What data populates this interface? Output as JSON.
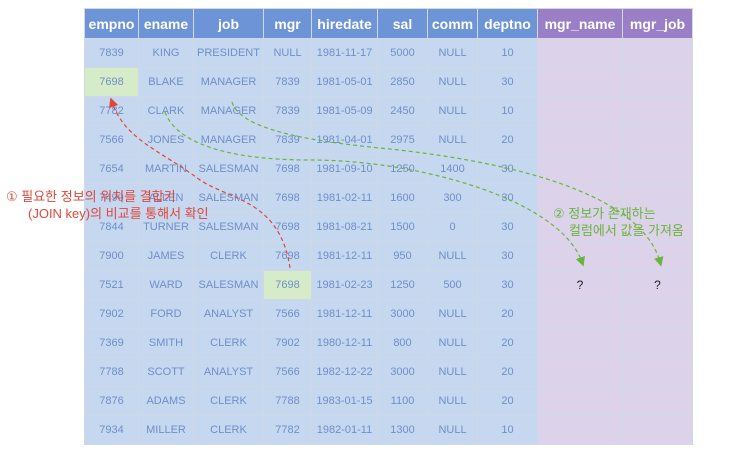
{
  "columns": [
    "empno",
    "ename",
    "job",
    "mgr",
    "hiredate",
    "sal",
    "comm",
    "deptno",
    "mgr_name",
    "mgr_job"
  ],
  "rows": [
    [
      "7839",
      "KING",
      "PRESIDENT",
      "NULL",
      "1981-11-17",
      "5000",
      "NULL",
      "10",
      "",
      ""
    ],
    [
      "7698",
      "BLAKE",
      "MANAGER",
      "7839",
      "1981-05-01",
      "2850",
      "NULL",
      "30",
      "",
      ""
    ],
    [
      "7782",
      "CLARK",
      "MANAGER",
      "7839",
      "1981-05-09",
      "2450",
      "NULL",
      "10",
      "",
      ""
    ],
    [
      "7566",
      "JONES",
      "MANAGER",
      "7839",
      "1981-04-01",
      "2975",
      "NULL",
      "20",
      "",
      ""
    ],
    [
      "7654",
      "MARTIN",
      "SALESMAN",
      "7698",
      "1981-09-10",
      "1250",
      "1400",
      "30",
      "",
      ""
    ],
    [
      "7499",
      "ALLEN",
      "SALESMAN",
      "7698",
      "1981-02-11",
      "1600",
      "300",
      "30",
      "",
      ""
    ],
    [
      "7844",
      "TURNER",
      "SALESMAN",
      "7698",
      "1981-08-21",
      "1500",
      "0",
      "30",
      "",
      ""
    ],
    [
      "7900",
      "JAMES",
      "CLERK",
      "7698",
      "1981-12-11",
      "950",
      "NULL",
      "30",
      "",
      ""
    ],
    [
      "7521",
      "WARD",
      "SALESMAN",
      "7698",
      "1981-02-23",
      "1250",
      "500",
      "30",
      "?",
      "?"
    ],
    [
      "7902",
      "FORD",
      "ANALYST",
      "7566",
      "1981-12-11",
      "3000",
      "NULL",
      "20",
      "",
      ""
    ],
    [
      "7369",
      "SMITH",
      "CLERK",
      "7902",
      "1980-12-11",
      "800",
      "NULL",
      "20",
      "",
      ""
    ],
    [
      "7788",
      "SCOTT",
      "ANALYST",
      "7566",
      "1982-12-22",
      "3000",
      "NULL",
      "20",
      "",
      ""
    ],
    [
      "7876",
      "ADAMS",
      "CLERK",
      "7788",
      "1983-01-15",
      "1100",
      "NULL",
      "20",
      "",
      ""
    ],
    [
      "7934",
      "MILLER",
      "CLERK",
      "7782",
      "1982-01-11",
      "1300",
      "NULL",
      "10",
      "",
      ""
    ]
  ],
  "highlighted_cells": [
    [
      1,
      0
    ],
    [
      8,
      3
    ]
  ],
  "annotations": {
    "step1_line1": "① 필요한 정보의 위치를 결합키",
    "step1_line2": "(JOIN key)의 비교를 통해서 확인",
    "step2_line1": "② 정보가 존재하는",
    "step2_line2": "컬럼에서 값을 가져옴"
  },
  "colors": {
    "header_blue": "#6d94d6",
    "header_purple": "#9a7ec6",
    "cell_blue": "#c6d7f0",
    "cell_purple": "#dcd2ea",
    "highlight_green": "#d6ebc8",
    "arrow_red": "#e0463a",
    "arrow_green": "#6cb33f"
  }
}
